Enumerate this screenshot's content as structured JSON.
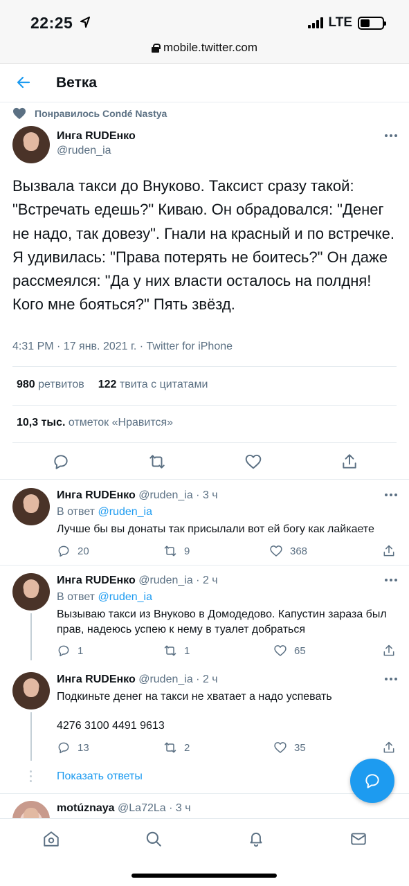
{
  "status": {
    "time": "22:25",
    "network": "LTE"
  },
  "browser": {
    "url": "mobile.twitter.com"
  },
  "header": {
    "title": "Ветка"
  },
  "liked_by": "Понравилось Condé Nastya",
  "main_tweet": {
    "name": "Инга RUDEнко",
    "handle": "@ruden_ia",
    "text": "Вызвала такси до Внуково. Таксист сразу такой: \"Встречать едешь?\" Киваю. Он обрадовался: \"Денег не надо, так довезу\". Гнали на красный и по встречке. Я удивилась: \"Права потерять не боитесь?\" Он даже рассмеялся: \"Да у них власти осталось на полдня! Кого мне бояться?\" Пять звёзд.",
    "meta": "4:31 PM · 17 янв. 2021 г. · Twitter for iPhone",
    "retweets_count": "980",
    "retweets_label": "ретвитов",
    "quotes_count": "122",
    "quotes_label": "твита с цитатами",
    "likes_count": "10,3 тыс.",
    "likes_label": "отметок «Нравится»"
  },
  "replies": [
    {
      "name": "Инга RUDEнко",
      "handle": "@ruden_ia",
      "time": "· 3 ч",
      "reply_prefix": "В ответ",
      "reply_to": "@ruden_ia",
      "text": "Лучше бы вы донаты так присылали вот ей богу как лайкаете",
      "comments": "20",
      "retweets": "9",
      "likes": "368"
    },
    {
      "name": "Инга RUDEнко",
      "handle": "@ruden_ia",
      "time": "· 2 ч",
      "reply_prefix": "В ответ",
      "reply_to": "@ruden_ia",
      "text": "Вызываю такси из Внуково в Домодедово. Капустин зараза был прав, надеюсь успею к нему в туалет добраться",
      "comments": "1",
      "retweets": "1",
      "likes": "65"
    },
    {
      "name": "Инга RUDEнко",
      "handle": "@ruden_ia",
      "time": "· 2 ч",
      "text": "Подкиньте денег на такси не хватает а надо успевать",
      "text2": "4276 3100 4491 9613",
      "comments": "13",
      "retweets": "2",
      "likes": "35"
    }
  ],
  "show_replies": "Показать ответы",
  "next_reply": {
    "name": "motúznaya",
    "handle": "@La72La",
    "time": "· 3 ч"
  },
  "colors": {
    "accent": "#1d9bf0",
    "muted": "#5b7083",
    "text": "#0f1419"
  }
}
